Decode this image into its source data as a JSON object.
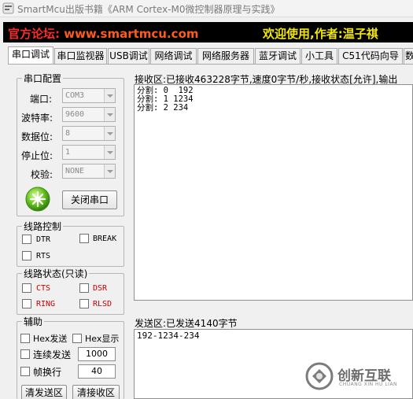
{
  "window": {
    "title": "SmartMcu出版书籍《ARM Cortex-M0微控制器原理与实践》"
  },
  "banner": {
    "site_zh": "官方论坛:",
    "site_url": " www.smartmcu.com",
    "welcome": "欢迎使用,作者:温子祺"
  },
  "tabs": [
    "串口调试",
    "串口监视器",
    "USB调试",
    "网络调试",
    "网络服务器",
    "蓝牙调试",
    "小工具",
    "C51代码向导",
    "数"
  ],
  "serial_config": {
    "title": "串口配置",
    "port": {
      "label": "端口:",
      "value": "COM3"
    },
    "baud": {
      "label": "波特率:",
      "value": "9600"
    },
    "databits": {
      "label": "数据位:",
      "value": "8"
    },
    "stopbits": {
      "label": "停止位:",
      "value": "1"
    },
    "parity": {
      "label": "校验:",
      "value": "NONE"
    },
    "close_button": "关闭串口"
  },
  "line_control": {
    "title": "线路控制",
    "dtr": "DTR",
    "break": "BREAK",
    "rts": "RTS"
  },
  "line_status": {
    "title": "线路状态(只读)",
    "cts": "CTS",
    "dsr": "DSR",
    "ring": "RING",
    "rlsd": "RLSD"
  },
  "aux": {
    "title": "辅助",
    "hex_send": "Hex发送",
    "hex_show": "Hex显示",
    "continuous_send": "连续发送",
    "continuous_value": "1000",
    "frame_wrap": "帧换行",
    "frame_value": "40",
    "clear_send": "清发送区",
    "clear_recv": "清接收区"
  },
  "receive": {
    "status": "接收区:已接收463228字节,速度0字节/秒,接收状态[允许],输出",
    "lines": [
      "分割: 0  192",
      "分割: 1 1234",
      "分割: 2 234"
    ]
  },
  "send": {
    "status": "发送区:已发送4140字节",
    "content": "192-1234-234"
  },
  "watermark": {
    "cn": "创新互联",
    "en": "CHUANG XIN HU LIAN"
  },
  "colors": {
    "banner_bg": "#000000",
    "banner_site": "#ff2a2a",
    "banner_welcome": "#f2e600",
    "status_red": "#c00000",
    "led_green": "#4caf1e"
  }
}
